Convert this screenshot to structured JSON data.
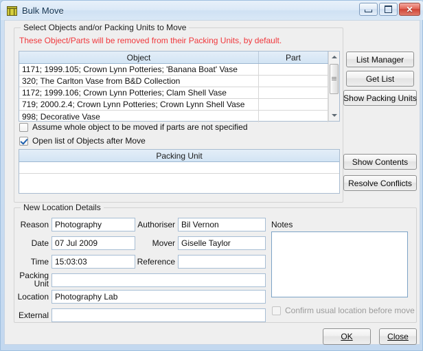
{
  "window": {
    "title": "Bulk Move",
    "icon": "crate-icon",
    "controls": {
      "minimize": "minimize-icon",
      "maximize": "maximize-icon",
      "close": "close-icon"
    },
    "accent": "#cfe0f2",
    "close_color": "#cf4436"
  },
  "select_group": {
    "legend": "Select Objects and/or Packing Units to Move",
    "warning": "These Object/Parts will be removed from their Packing Units, by default.",
    "warning_color": "#f0373b",
    "object_grid": {
      "columns": [
        "Object",
        "Part"
      ],
      "rows": [
        {
          "object": "1171; 1999.105; Crown Lynn Potteries; 'Banana Boat' Vase",
          "part": ""
        },
        {
          "object": "320; The Carlton Vase from B&D Collection",
          "part": ""
        },
        {
          "object": "1172; 1999.106; Crown Lynn Potteries; Clam Shell Vase",
          "part": ""
        },
        {
          "object": "719; 2000.2.4; Crown Lynn Potteries; Crown Lynn Shell Vase",
          "part": ""
        },
        {
          "object": "998; Decorative Vase",
          "part": ""
        }
      ]
    },
    "buttons": {
      "list_manager": "List Manager",
      "get_list": "Get List",
      "show_packing_units": "Show Packing Units"
    },
    "checkboxes": [
      {
        "label": "Assume whole object to be moved if parts are not specified",
        "checked": false
      },
      {
        "label": "Open list of Objects after Move",
        "checked": true
      }
    ],
    "packing_grid": {
      "columns": [
        "Packing Unit"
      ],
      "rows": [
        {
          "packing_unit": ""
        }
      ]
    },
    "packing_buttons": {
      "show_contents": "Show Contents",
      "resolve_conflicts": "Resolve Conflicts"
    }
  },
  "location_group": {
    "legend": "New Location Details",
    "fields": {
      "reason": {
        "label": "Reason",
        "value": "Photography"
      },
      "date": {
        "label": "Date",
        "value": "07 Jul 2009"
      },
      "time": {
        "label": "Time",
        "value": "15:03:03"
      },
      "packing_unit": {
        "label": "Packing Unit",
        "label_line1": "Packing",
        "label_line2": "Unit",
        "value": ""
      },
      "location": {
        "label": "Location",
        "value": "Photography Lab"
      },
      "external": {
        "label": "External",
        "value": ""
      },
      "authoriser": {
        "label": "Authoriser",
        "value": "Bil Vernon"
      },
      "mover": {
        "label": "Mover",
        "value": "Giselle Taylor"
      },
      "reference": {
        "label": "Reference",
        "value": ""
      }
    },
    "notes": {
      "label": "Notes",
      "value": ""
    },
    "confirm_checkbox": {
      "label": "Confirm usual location before move",
      "checked": false,
      "disabled": true
    }
  },
  "footer": {
    "ok": "OK",
    "close": "Close"
  }
}
